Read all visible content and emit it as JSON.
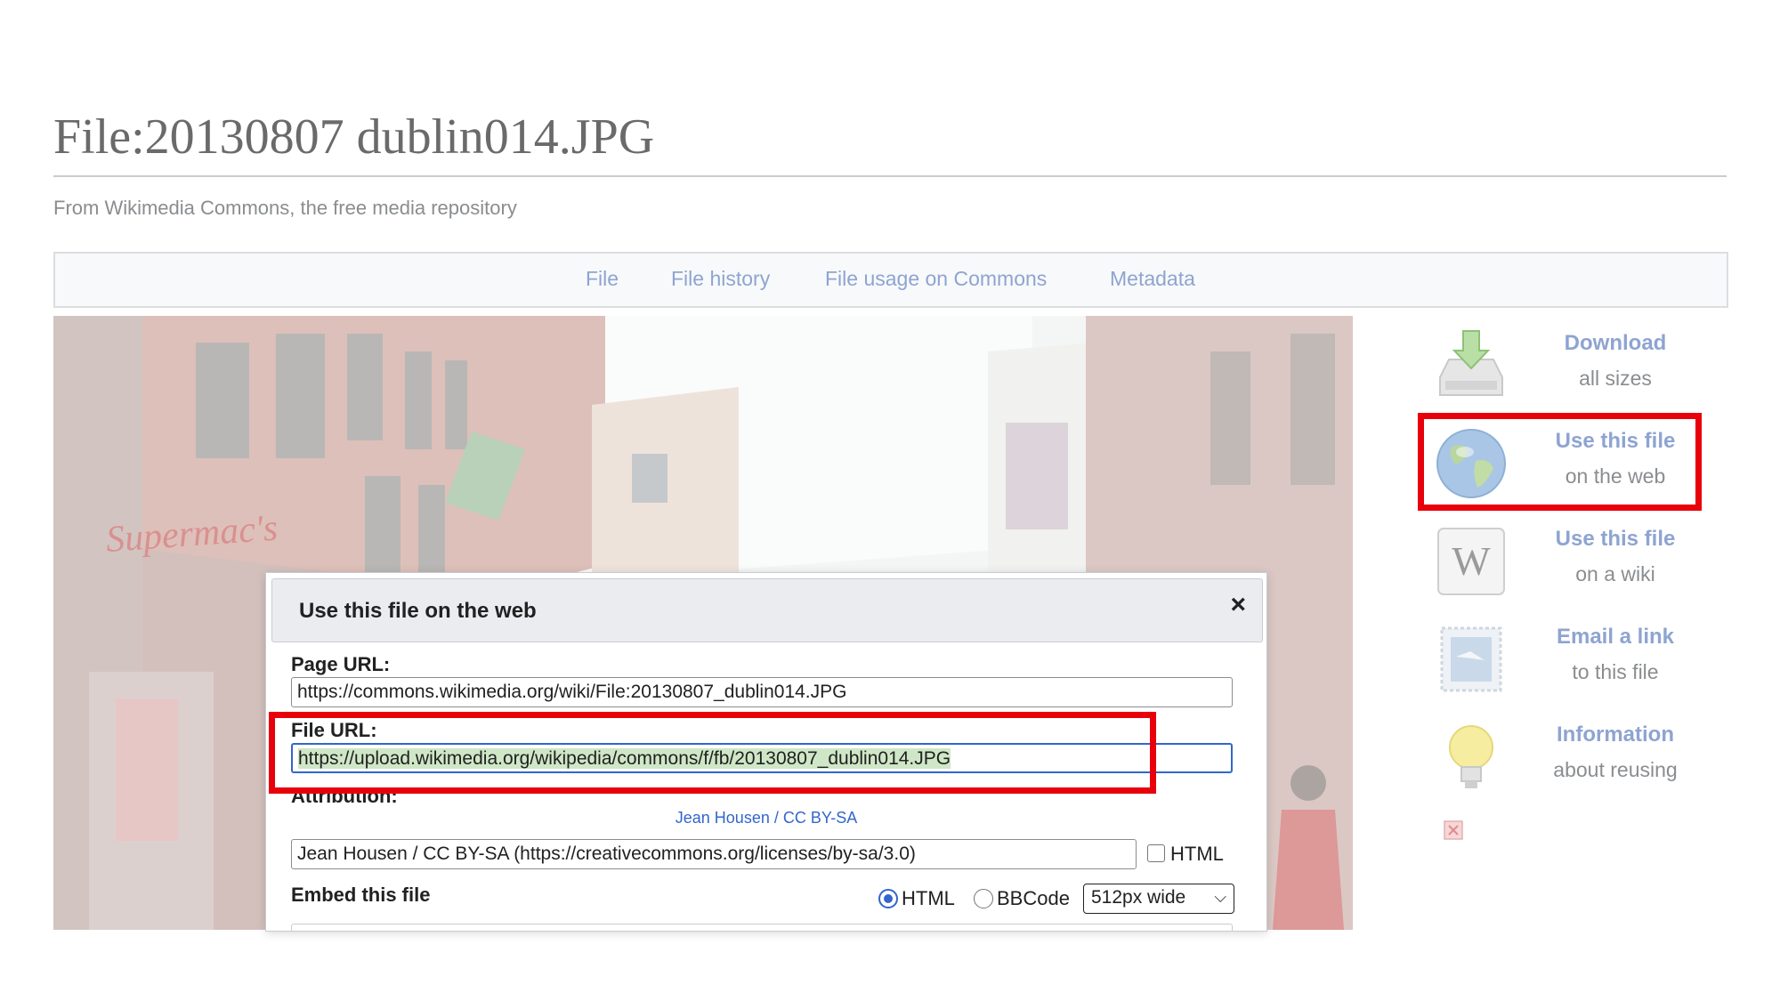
{
  "page": {
    "title": "File:20130807 dublin014.JPG",
    "subtitle": "From Wikimedia Commons, the free media repository"
  },
  "tabs": [
    {
      "label": "File"
    },
    {
      "label": "File history"
    },
    {
      "label": "File usage on Commons"
    },
    {
      "label": "Metadata"
    }
  ],
  "photo": {
    "storefront_sign": "Supermac's"
  },
  "dialog": {
    "title": "Use this file on the web",
    "close_glyph": "×",
    "page_url_label": "Page URL:",
    "page_url_value": "https://commons.wikimedia.org/wiki/File:20130807_dublin014.JPG",
    "file_url_label": "File URL:",
    "file_url_value": "https://upload.wikimedia.org/wikipedia/commons/f/fb/20130807_dublin014.JPG",
    "attribution_label": "Attribution:",
    "attribution_author": "Jean Housen",
    "attribution_sep": " / ",
    "attribution_license": "CC BY-SA",
    "attribution_text": "Jean Housen / CC BY-SA (https://creativecommons.org/licenses/by-sa/3.0)",
    "html_checkbox_label": "HTML",
    "html_checkbox_checked": false,
    "embed_label": "Embed this file",
    "embed_formats": [
      {
        "label": "HTML",
        "selected": true
      },
      {
        "label": "BBCode",
        "selected": false
      }
    ],
    "size_select_value": "512px wide"
  },
  "sidebar": {
    "items": [
      {
        "main": "Download",
        "sub": "all sizes",
        "icon": "download-icon"
      },
      {
        "main": "Use this file",
        "sub": "on the web",
        "icon": "globe-icon"
      },
      {
        "main": "Use this file",
        "sub": "on a wiki",
        "icon": "wikipedia-w-icon"
      },
      {
        "main": "Email a link",
        "sub": "to this file",
        "icon": "email-stamp-icon"
      },
      {
        "main": "Information",
        "sub": "about reusing",
        "icon": "lightbulb-icon"
      }
    ]
  },
  "colors": {
    "highlight": "#e8000b",
    "link": "#3366cc",
    "selection": "#cfe7c6"
  }
}
